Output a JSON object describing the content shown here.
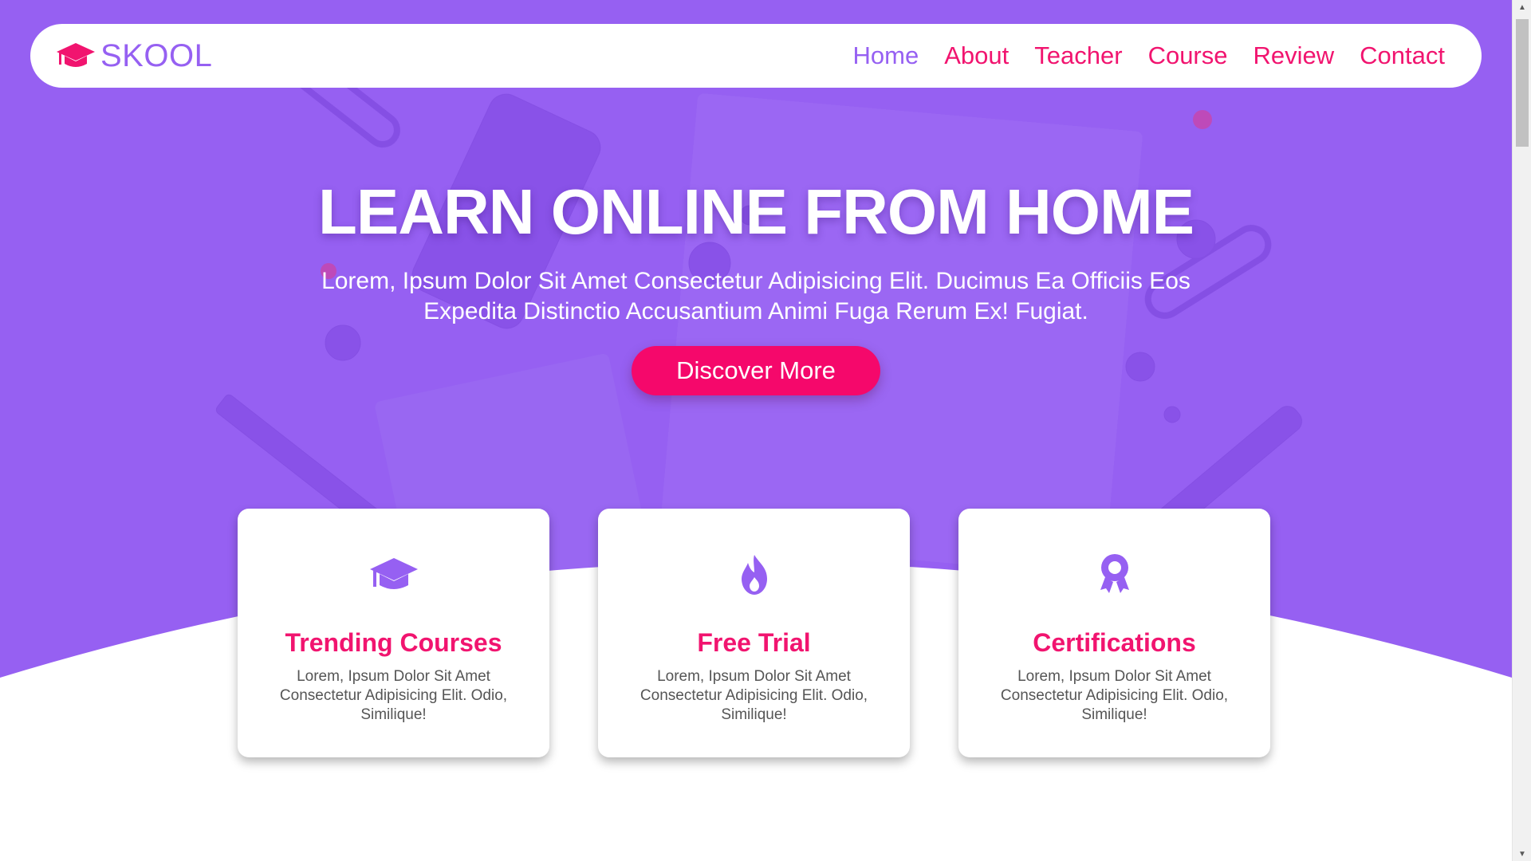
{
  "brand": {
    "name": "SKOOL",
    "icon": "graduation-cap-icon"
  },
  "nav": {
    "items": [
      {
        "label": "Home",
        "active": true
      },
      {
        "label": "About",
        "active": false
      },
      {
        "label": "Teacher",
        "active": false
      },
      {
        "label": "Course",
        "active": false
      },
      {
        "label": "Review",
        "active": false
      },
      {
        "label": "Contact",
        "active": false
      }
    ]
  },
  "hero": {
    "title": "LEARN ONLINE FROM HOME",
    "subtitle": "Lorem, Ipsum Dolor Sit Amet Consectetur Adipisicing Elit. Ducimus Ea Officiis Eos Expedita Distinctio Accusantium Animi Fuga Rerum Ex! Fugiat.",
    "button_label": "Discover More"
  },
  "cards": [
    {
      "icon": "graduation-cap-icon",
      "title": "Trending Courses",
      "text": "Lorem, Ipsum Dolor Sit Amet Consectetur Adipisicing Elit. Odio, Similique!"
    },
    {
      "icon": "fire-icon",
      "title": "Free Trial",
      "text": "Lorem, Ipsum Dolor Sit Amet Consectetur Adipisicing Elit. Odio, Similique!"
    },
    {
      "icon": "award-icon",
      "title": "Certifications",
      "text": "Lorem, Ipsum Dolor Sit Amet Consectetur Adipisicing Elit. Odio, Similique!"
    }
  ],
  "colors": {
    "primary_purple": "#9660f2",
    "accent_pink": "#f1146f",
    "button_pink": "#f5086b",
    "text_gray": "#555555"
  }
}
